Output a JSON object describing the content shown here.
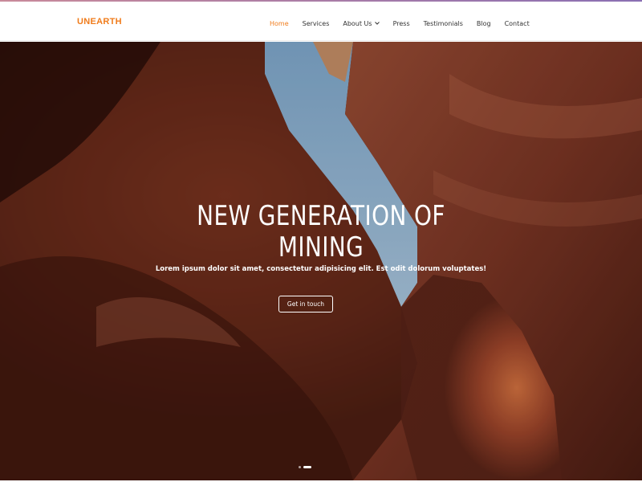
{
  "header": {
    "logo": "UNEARTH",
    "nav": [
      {
        "label": "Home",
        "active": true
      },
      {
        "label": "Services"
      },
      {
        "label": "About Us",
        "has_dropdown": true
      },
      {
        "label": "Press"
      },
      {
        "label": "Testimonials"
      },
      {
        "label": "Blog"
      },
      {
        "label": "Contact"
      }
    ],
    "accent_color": "#f07c1c"
  },
  "hero": {
    "title_line1": "NEW GENERATION OF",
    "title_line2": "MINING",
    "subtitle": "Lorem ipsum dolor sit amet, consectetur adipisicing elit. Est odit dolorum voluptates!",
    "cta_label": "Get in touch",
    "background": "canyon-rock-photo",
    "slider": {
      "slides": 2,
      "active": 2
    }
  }
}
